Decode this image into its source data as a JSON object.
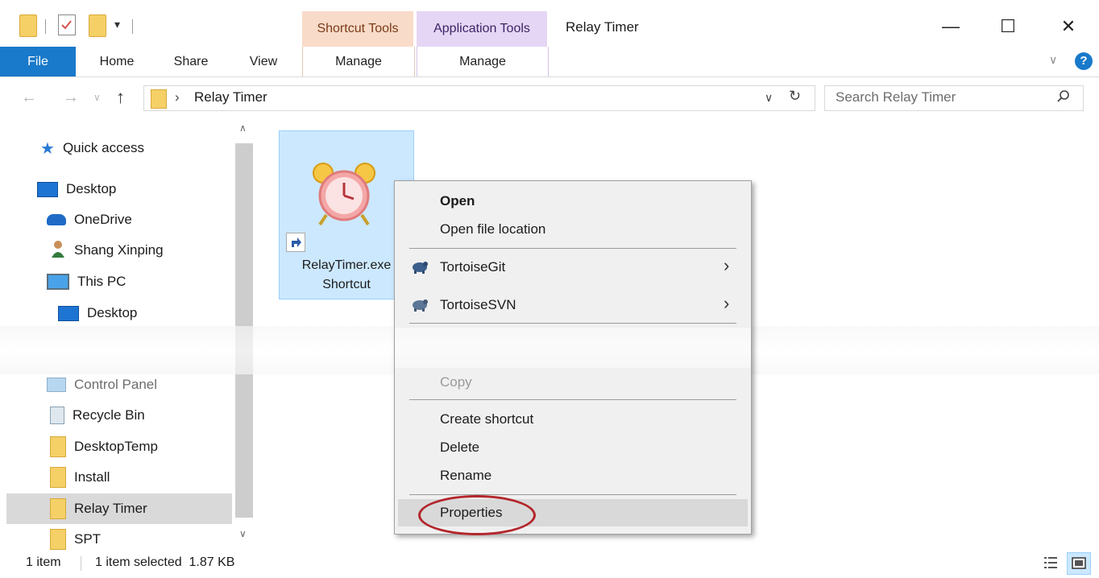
{
  "window": {
    "title": "Relay Timer",
    "contextual_tabs": [
      {
        "label": "Shortcut Tools",
        "color": "#f9dbc9",
        "text_color": "#7a3b16"
      },
      {
        "label": "Application Tools",
        "color": "#e6d6f5",
        "text_color": "#3c2466"
      }
    ],
    "controls": {
      "minimize": "—",
      "maximize": "☐",
      "close": "✕"
    }
  },
  "ribbon": {
    "tabs": [
      "File",
      "Home",
      "Share",
      "View",
      "Manage",
      "Manage"
    ]
  },
  "address_bar": {
    "path": "Relay Timer",
    "separator": "›",
    "search_placeholder": "Search Relay Timer",
    "icons": [
      "back-arrow-icon",
      "forward-arrow-icon",
      "recent-chevron-icon",
      "up-arrow-icon",
      "refresh-icon",
      "search-icon"
    ]
  },
  "nav_pane": {
    "items": [
      {
        "label": "Quick access",
        "icon": "star-icon"
      },
      {
        "label": "Desktop",
        "icon": "desktop-icon"
      },
      {
        "label": "OneDrive",
        "icon": "cloud-icon"
      },
      {
        "label": "Shang Xinping",
        "icon": "user-icon"
      },
      {
        "label": "This PC",
        "icon": "computer-icon"
      },
      {
        "label": "Desktop",
        "icon": "desktop-icon"
      },
      {
        "label": "Control Panel",
        "icon": "control-panel-icon"
      },
      {
        "label": "Recycle Bin",
        "icon": "recycle-bin-icon"
      },
      {
        "label": "DesktopTemp",
        "icon": "folder-icon"
      },
      {
        "label": "Install",
        "icon": "folder-icon"
      },
      {
        "label": "Relay Timer",
        "icon": "folder-icon",
        "selected": true
      },
      {
        "label": "SPT",
        "icon": "folder-icon"
      }
    ]
  },
  "file_item": {
    "name_line1": "RelayTimer.exe",
    "name_line2": "Shortcut",
    "icon": "alarm-clock-icon"
  },
  "context_menu": {
    "items": [
      {
        "label": "Open",
        "bold": true
      },
      {
        "label": "Open file location"
      },
      {
        "label": "TortoiseGit",
        "submenu": true
      },
      {
        "label": "TortoiseSVN",
        "submenu": true
      },
      {
        "label": "Copy"
      },
      {
        "label": "Create shortcut"
      },
      {
        "label": "Delete"
      },
      {
        "label": "Rename"
      },
      {
        "label": "Properties",
        "highlighted": true
      }
    ]
  },
  "status_bar": {
    "count": "1 item",
    "selection": "1 item selected  1.87 KB"
  }
}
